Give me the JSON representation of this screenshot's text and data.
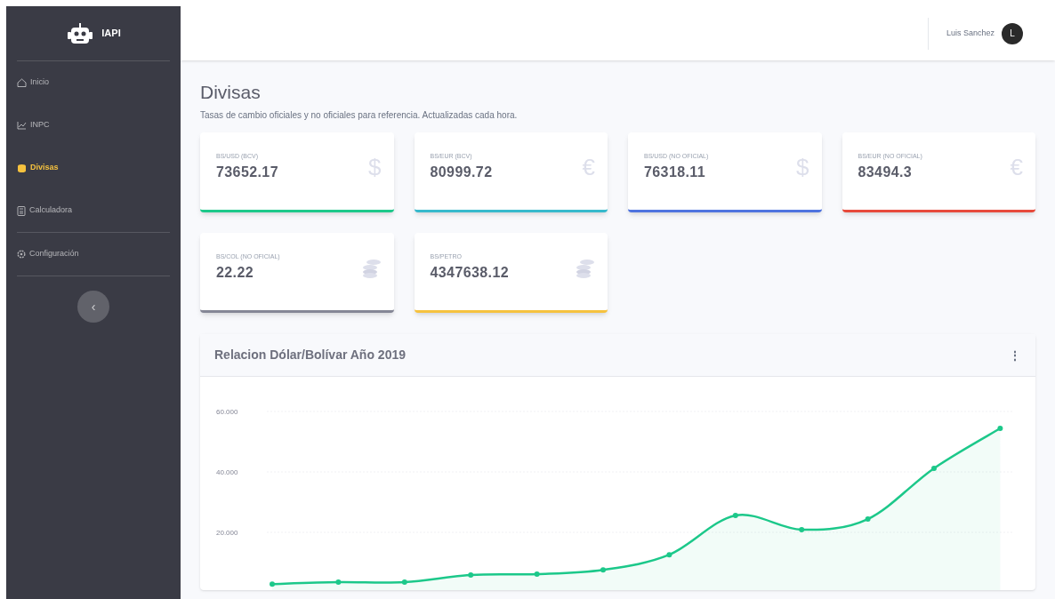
{
  "brand": {
    "name": "IAPI"
  },
  "sidebar": {
    "items": [
      {
        "label": "Inicio",
        "selected": false
      },
      {
        "label": "INPC",
        "selected": false
      },
      {
        "label": "Divisas",
        "selected": true
      },
      {
        "label": "Calculadora",
        "selected": false
      },
      {
        "label": "Configuración",
        "selected": false
      }
    ],
    "toggle": "‹"
  },
  "topbar": {
    "user": "Luis Sanchez",
    "avatar": "L"
  },
  "page": {
    "title": "Divisas",
    "subtitle": "Tasas de cambio oficiales y no oficiales para referencia. Actualizadas cada hora."
  },
  "cards": [
    {
      "label": "BS/USD (BCV)",
      "value": "73652.17",
      "icon": "$",
      "color": "#1cc88a"
    },
    {
      "label": "BS/EUR (BCV)",
      "value": "80999.72",
      "icon": "€",
      "color": "#36b9cc"
    },
    {
      "label": "BS/USD (NO OFICIAL)",
      "value": "76318.11",
      "icon": "$",
      "color": "#4e73df"
    },
    {
      "label": "BS/EUR (NO OFICIAL)",
      "value": "83494.3",
      "icon": "€",
      "color": "#e74a3b"
    },
    {
      "label": "BS/COL (NO OFICIAL)",
      "value": "22.22",
      "color": "#858796"
    },
    {
      "label": "BS/PETRO",
      "value": "4347638.12",
      "color": "#f6c23e"
    }
  ],
  "chart_card": {
    "title": "Relacion Dólar/Bolívar Año 2019",
    "menu": "⋮",
    "chart_data": {
      "type": "area",
      "ylim": [
        0,
        60
      ],
      "yticks": [
        {
          "value": 20,
          "label": "20.000"
        },
        {
          "value": 40,
          "label": "40.000"
        },
        {
          "value": 60,
          "label": "60.000"
        }
      ],
      "series": [
        {
          "color": "#1cc88a",
          "values": [
            2.9,
            3.5,
            3.5,
            5.9,
            6.2,
            7.6,
            12.6,
            25.6,
            20.9,
            24.4,
            41.2,
            54.4
          ]
        }
      ]
    }
  }
}
